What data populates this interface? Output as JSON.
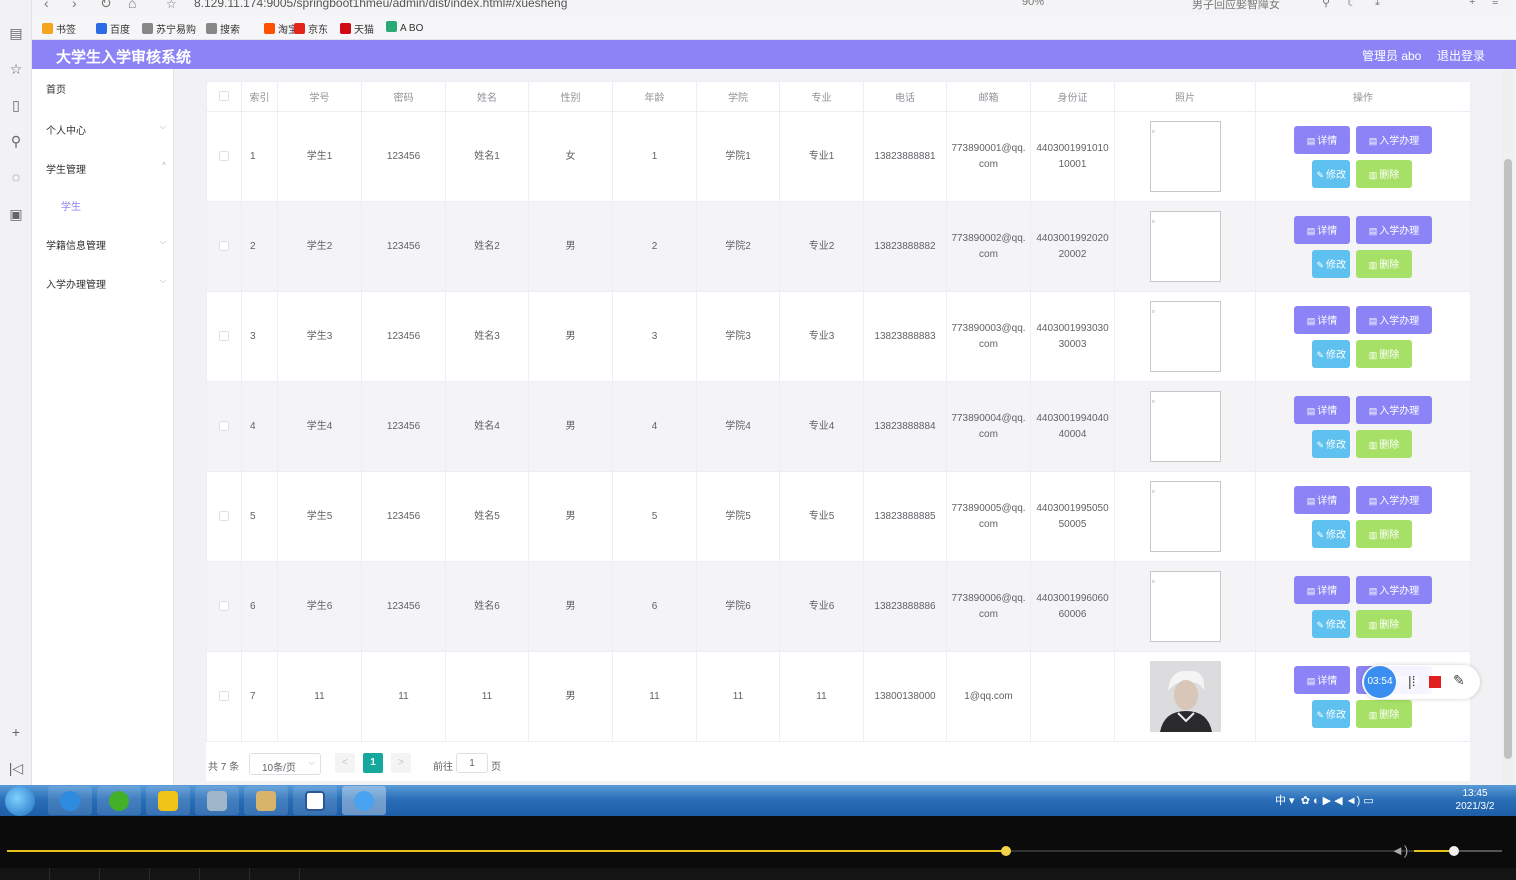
{
  "browser": {
    "url": "8.129.11.174:9005/springboot1hmeu/admin/dist/index.html#/xuesheng",
    "zoom": "90%",
    "search_hint": "男子回应娶智障女",
    "bookmarks": [
      {
        "label": "书签",
        "color": "#f4a51c"
      },
      {
        "label": "百度",
        "color": "#2d6be4"
      },
      {
        "label": "苏宁易购",
        "color": "#888888"
      },
      {
        "label": "搜索",
        "color": "#888888"
      },
      {
        "label": "淘宝",
        "color": "#ff5000"
      },
      {
        "label": "京东",
        "color": "#e1251b"
      },
      {
        "label": "天猫",
        "color": "#d20a14"
      },
      {
        "label": "A BO",
        "color": "#2aa876"
      }
    ]
  },
  "app": {
    "title": "大学生入学审核系统",
    "user": "管理员 abo",
    "logout": "退出登录",
    "accent": "#8c84f6"
  },
  "sidebar": {
    "items": [
      {
        "label": "首页",
        "has_chevron": false
      },
      {
        "label": "个人中心",
        "has_chevron": true,
        "chevron": "down"
      },
      {
        "label": "学生管理",
        "has_chevron": true,
        "chevron": "up"
      },
      {
        "label": "学籍信息管理",
        "has_chevron": true,
        "chevron": "down"
      },
      {
        "label": "入学办理管理",
        "has_chevron": true,
        "chevron": "down"
      }
    ],
    "sub_item": "学生"
  },
  "table": {
    "headers": [
      "索引",
      "学号",
      "密码",
      "姓名",
      "性别",
      "年龄",
      "学院",
      "专业",
      "电话",
      "邮箱",
      "身份证",
      "照片",
      "操作"
    ],
    "rows": [
      {
        "idx": "1",
        "xuehao": "学生1",
        "mima": "123456",
        "xingming": "姓名1",
        "xingbie": "女",
        "nianling": "1",
        "xueyuan": "学院1",
        "zhuanye": "专业1",
        "dianhua": "13823888881",
        "youxiang": "773890001@qq.com",
        "shenfenzheng": "440300199101010001",
        "photo": "broken"
      },
      {
        "idx": "2",
        "xuehao": "学生2",
        "mima": "123456",
        "xingming": "姓名2",
        "xingbie": "男",
        "nianling": "2",
        "xueyuan": "学院2",
        "zhuanye": "专业2",
        "dianhua": "13823888882",
        "youxiang": "773890002@qq.com",
        "shenfenzheng": "440300199202020002",
        "photo": "broken"
      },
      {
        "idx": "3",
        "xuehao": "学生3",
        "mima": "123456",
        "xingming": "姓名3",
        "xingbie": "男",
        "nianling": "3",
        "xueyuan": "学院3",
        "zhuanye": "专业3",
        "dianhua": "13823888883",
        "youxiang": "773890003@qq.com",
        "shenfenzheng": "440300199303030003",
        "photo": "broken"
      },
      {
        "idx": "4",
        "xuehao": "学生4",
        "mima": "123456",
        "xingming": "姓名4",
        "xingbie": "男",
        "nianling": "4",
        "xueyuan": "学院4",
        "zhuanye": "专业4",
        "dianhua": "13823888884",
        "youxiang": "773890004@qq.com",
        "shenfenzheng": "440300199404040004",
        "photo": "broken"
      },
      {
        "idx": "5",
        "xuehao": "学生5",
        "mima": "123456",
        "xingming": "姓名5",
        "xingbie": "男",
        "nianling": "5",
        "xueyuan": "学院5",
        "zhuanye": "专业5",
        "dianhua": "13823888885",
        "youxiang": "773890005@qq.com",
        "shenfenzheng": "440300199505050005",
        "photo": "broken"
      },
      {
        "idx": "6",
        "xuehao": "学生6",
        "mima": "123456",
        "xingming": "姓名6",
        "xingbie": "男",
        "nianling": "6",
        "xueyuan": "学院6",
        "zhuanye": "专业6",
        "dianhua": "13823888886",
        "youxiang": "773890006@qq.com",
        "shenfenzheng": "440300199606060006",
        "photo": "broken"
      },
      {
        "idx": "7",
        "xuehao": "11",
        "mima": "11",
        "xingming": "11",
        "xingbie": "男",
        "nianling": "11",
        "xueyuan": "11",
        "zhuanye": "11",
        "dianhua": "13800138000",
        "youxiang": "1@qq.com",
        "shenfenzheng": "",
        "photo": "portrait"
      }
    ],
    "actions": {
      "detail": "详情",
      "admit": "入学办理",
      "edit": "修改",
      "delete": "删除"
    },
    "action_colors": {
      "detail": "#8c84f6",
      "edit": "#5ec1ef",
      "delete": "#a6e067"
    }
  },
  "pagination": {
    "total": "共 7 条",
    "page_size": "10条/页",
    "prev": "<",
    "current": "1",
    "next": ">",
    "goto_label": "前往",
    "goto_value": "1",
    "goto_unit": "页"
  },
  "recorder": {
    "timer": "03:54"
  },
  "taskbar": {
    "tray_text": "中",
    "time": "13:45",
    "date": "2021/3/2",
    "apps": [
      "ie",
      "browser-green",
      "media-player",
      "explorer",
      "paint",
      "word",
      "bubble-app"
    ]
  },
  "player": {
    "progress": 0.668,
    "volume": 0.45
  }
}
